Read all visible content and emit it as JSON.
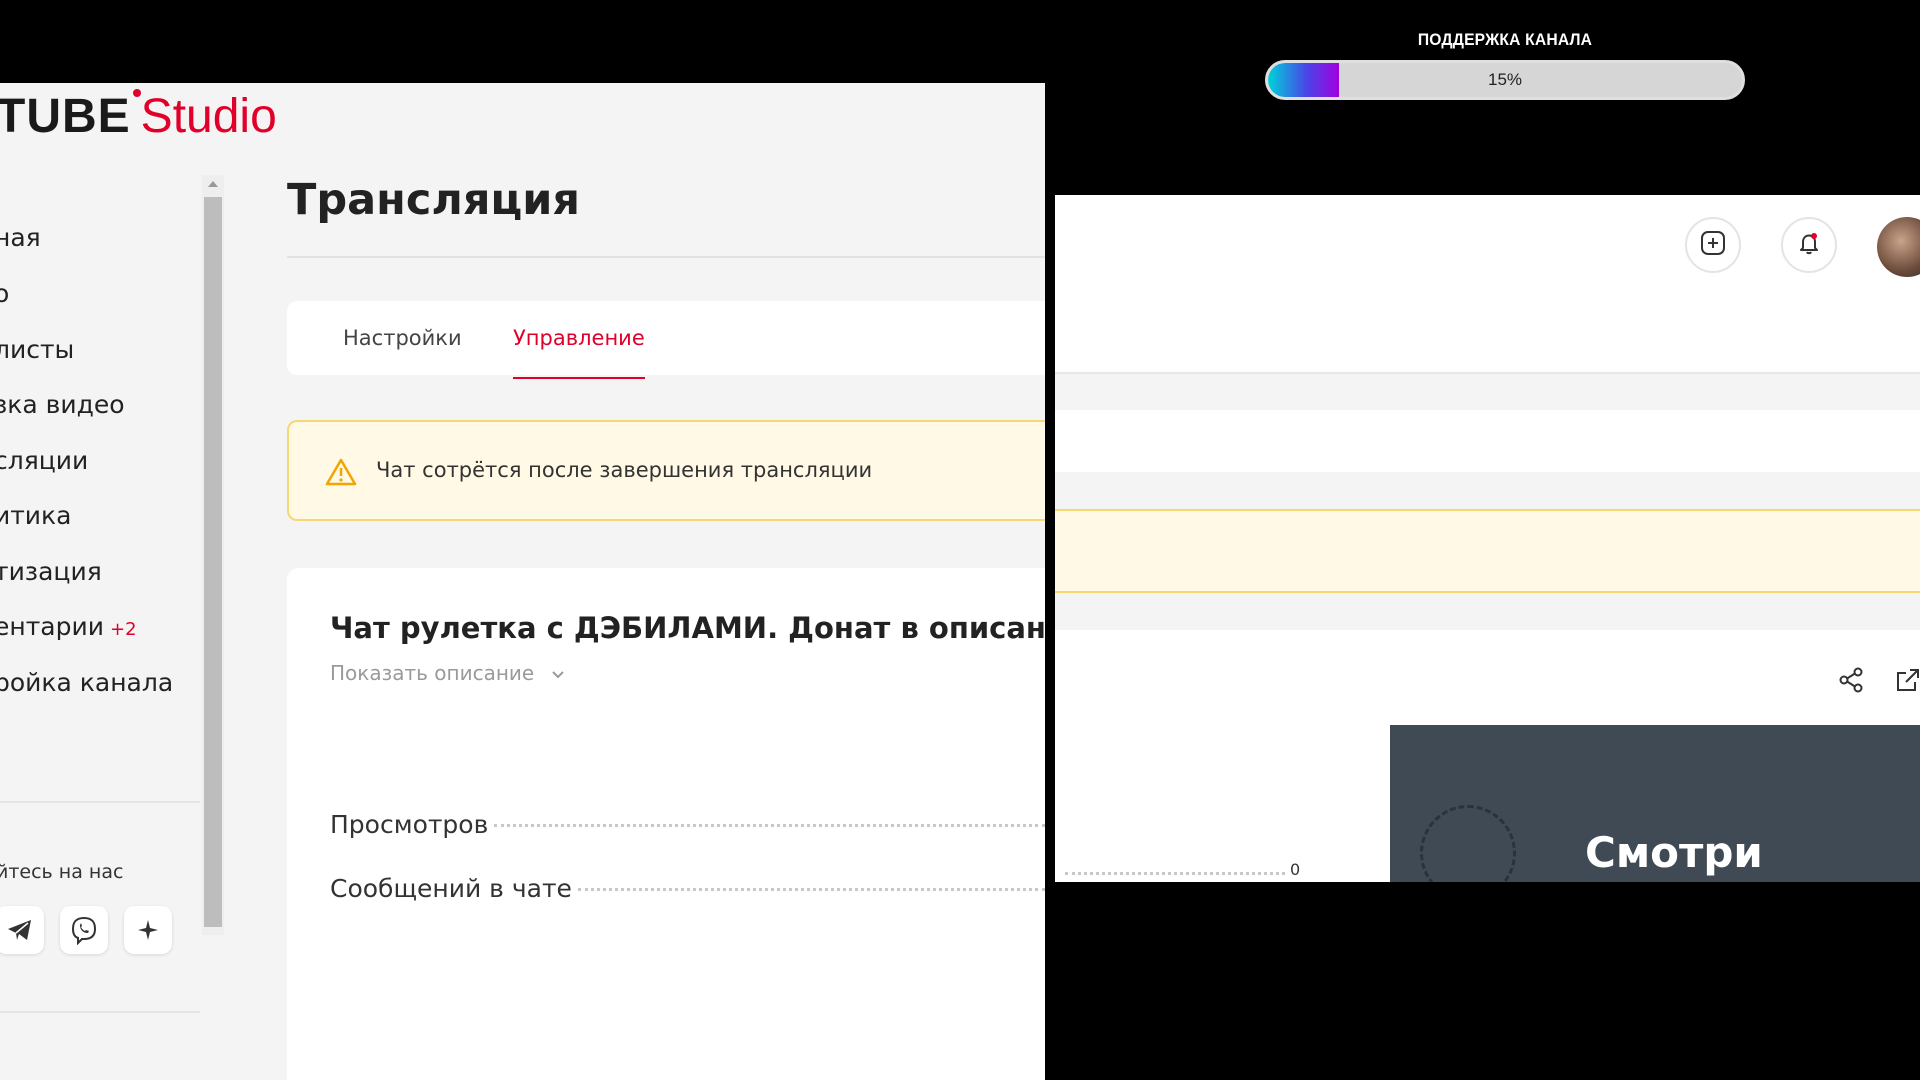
{
  "support": {
    "title": "ПОДДЕРЖКА КАНАЛА",
    "progress_label": "15%",
    "progress": 0.15
  },
  "logo": {
    "prefix": "TUBE",
    "suffix": "Studio",
    "brand_color": "#e0002a"
  },
  "sidebar": {
    "items": [
      {
        "label": "ная"
      },
      {
        "label": "о"
      },
      {
        "label": "листы"
      },
      {
        "label": "зка видео"
      },
      {
        "label": "сляции"
      },
      {
        "label": "итика"
      },
      {
        "label": "тизация"
      },
      {
        "label": "ентарии",
        "badge": "+2"
      },
      {
        "label": "ройка канала"
      }
    ],
    "follow_label": "йтесь на нас",
    "social_icons": [
      "telegram-icon",
      "viber-icon",
      "sparkle-icon"
    ]
  },
  "main": {
    "title": "Трансляция",
    "tabs": [
      {
        "label": "Настройки"
      },
      {
        "label": "Управление",
        "active": true
      }
    ],
    "alert": {
      "text": "Чат сотрётся после завершения трансляции"
    },
    "stream": {
      "title": "Чат рулетка с ДЭБИЛАМИ. Донат в описании",
      "show_description": "Показать описание",
      "stats": [
        {
          "label": "Просмотров"
        },
        {
          "label": "Сообщений в чате"
        }
      ]
    }
  },
  "right_panel": {
    "icons": [
      "add-icon",
      "bell-icon",
      "share-icon",
      "external-link-icon"
    ],
    "stat_value": "0",
    "preview_text": "Смотри"
  }
}
